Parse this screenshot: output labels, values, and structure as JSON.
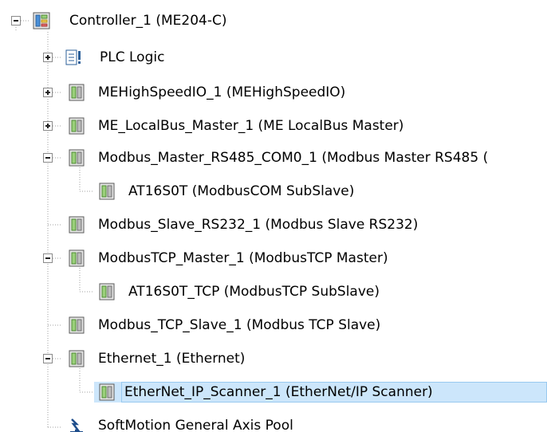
{
  "tree": {
    "items": [
      {
        "label": "Controller_1 (ME204-C)",
        "icon": "controller-icon",
        "state": "expanded"
      },
      {
        "label": "PLC Logic",
        "icon": "plc-logic-icon",
        "state": "collapsed"
      },
      {
        "label": "MEHighSpeedIO_1 (MEHighSpeedIO)",
        "icon": "device-icon",
        "state": "collapsed"
      },
      {
        "label": "ME_LocalBus_Master_1 (ME LocalBus Master)",
        "icon": "device-icon",
        "state": "collapsed"
      },
      {
        "label": "Modbus_Master_RS485_COM0_1 (Modbus Master RS485 (",
        "icon": "device-icon",
        "state": "expanded"
      },
      {
        "label": "AT16S0T (ModbusCOM SubSlave)",
        "icon": "device-icon",
        "state": "leaf"
      },
      {
        "label": "Modbus_Slave_RS232_1 (Modbus Slave RS232)",
        "icon": "device-icon",
        "state": "leaf"
      },
      {
        "label": "ModbusTCP_Master_1 (ModbusTCP Master)",
        "icon": "device-icon",
        "state": "expanded"
      },
      {
        "label": "AT16S0T_TCP (ModbusTCP SubSlave)",
        "icon": "device-icon",
        "state": "leaf"
      },
      {
        "label": "Modbus_TCP_Slave_1 (Modbus TCP Slave)",
        "icon": "device-icon",
        "state": "leaf"
      },
      {
        "label": "Ethernet_1 (Ethernet)",
        "icon": "device-icon",
        "state": "expanded"
      },
      {
        "label": "EtherNet_IP_Scanner_1 (EtherNet/IP Scanner)",
        "icon": "device-icon",
        "state": "leaf",
        "selected": true
      },
      {
        "label": "SoftMotion General Axis Pool",
        "icon": "axis-pool-icon",
        "state": "leaf"
      }
    ]
  },
  "colors": {
    "selection_bg": "#cce6fb",
    "selection_border": "#99c9ef",
    "guide_line": "#a0a0a0"
  }
}
